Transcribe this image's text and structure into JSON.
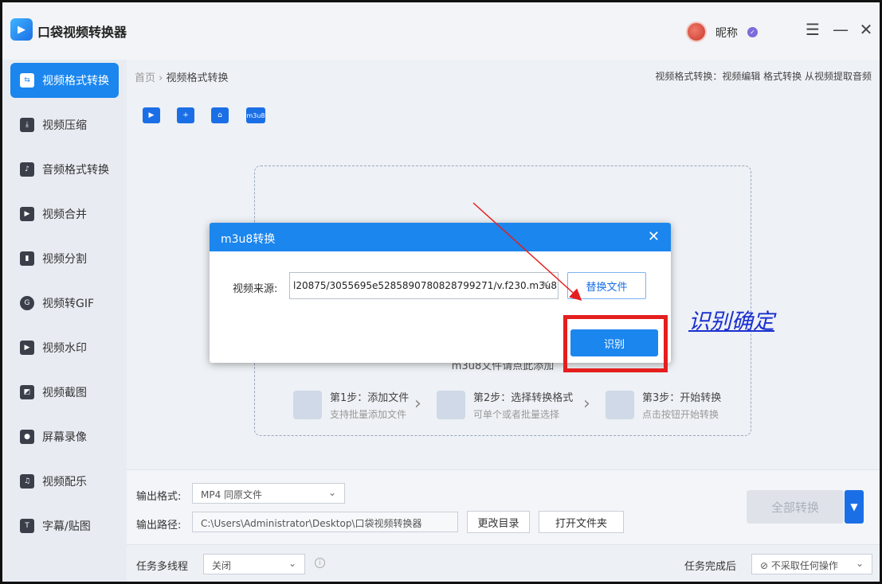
{
  "app": {
    "title": "口袋视频转换器",
    "logo_text": "▶"
  },
  "user": {
    "name": "昵称",
    "badge": "✓"
  },
  "window_controls": {
    "menu": "☰",
    "minimize": "—",
    "close": "✕"
  },
  "sidebar": {
    "items": [
      {
        "label": "视频格式转换",
        "icon": "convert-icon",
        "active": true
      },
      {
        "label": "视频压缩",
        "icon": "compress-icon"
      },
      {
        "label": "音频格式转换",
        "icon": "audio-icon"
      },
      {
        "label": "视频合并",
        "icon": "merge-icon"
      },
      {
        "label": "视频分割",
        "icon": "split-icon"
      },
      {
        "label": "视频转GIF",
        "icon": "gif-icon"
      },
      {
        "label": "视频水印",
        "icon": "watermark-icon"
      },
      {
        "label": "视频截图",
        "icon": "screenshot-icon"
      },
      {
        "label": "屏幕录像",
        "icon": "record-icon"
      },
      {
        "label": "视频配乐",
        "icon": "music-icon"
      },
      {
        "label": "字幕/贴图",
        "icon": "subtitle-icon"
      }
    ]
  },
  "main": {
    "breadcrumb": {
      "home": "首页",
      "separator": "›",
      "current": "视频格式转换"
    },
    "header_desc": "视频格式转换：视频编辑 格式转换 从视频提取音频",
    "toolbar": {
      "m3u8_label": "m3u8"
    },
    "drop_hint": "m3u8文件请点此添加",
    "steps": [
      {
        "title": "第1步：添加文件",
        "sub": "支持批量添加文件"
      },
      {
        "title": "第2步：选择转换格式",
        "sub": "可单个或者批量选择"
      },
      {
        "title": "第3步：开始转换",
        "sub": "点击按钮开始转换"
      }
    ]
  },
  "output": {
    "format_label": "输出格式:",
    "format_value": "MP4  同原文件",
    "path_label": "输出路径:",
    "path_value": "C:\\Users\\Administrator\\Desktop\\口袋视频转换器",
    "change_dir": "更改目录",
    "open_folder": "打开文件夹",
    "convert_all": "全部转换"
  },
  "footer": {
    "threads_label": "任务多线程",
    "threads_value": "关闭",
    "after_label": "任务完成后",
    "after_value": "不采取任何操作"
  },
  "dialog": {
    "title": "m3u8转换",
    "source_label": "视频来源:",
    "source_value": "l20875/3055695e5285890780828799271/v.f230.m3u8",
    "replace_button": "替换文件",
    "recognize_button": "识别"
  },
  "annotation": {
    "text": "识别确定",
    "color": "#e51e1e"
  }
}
